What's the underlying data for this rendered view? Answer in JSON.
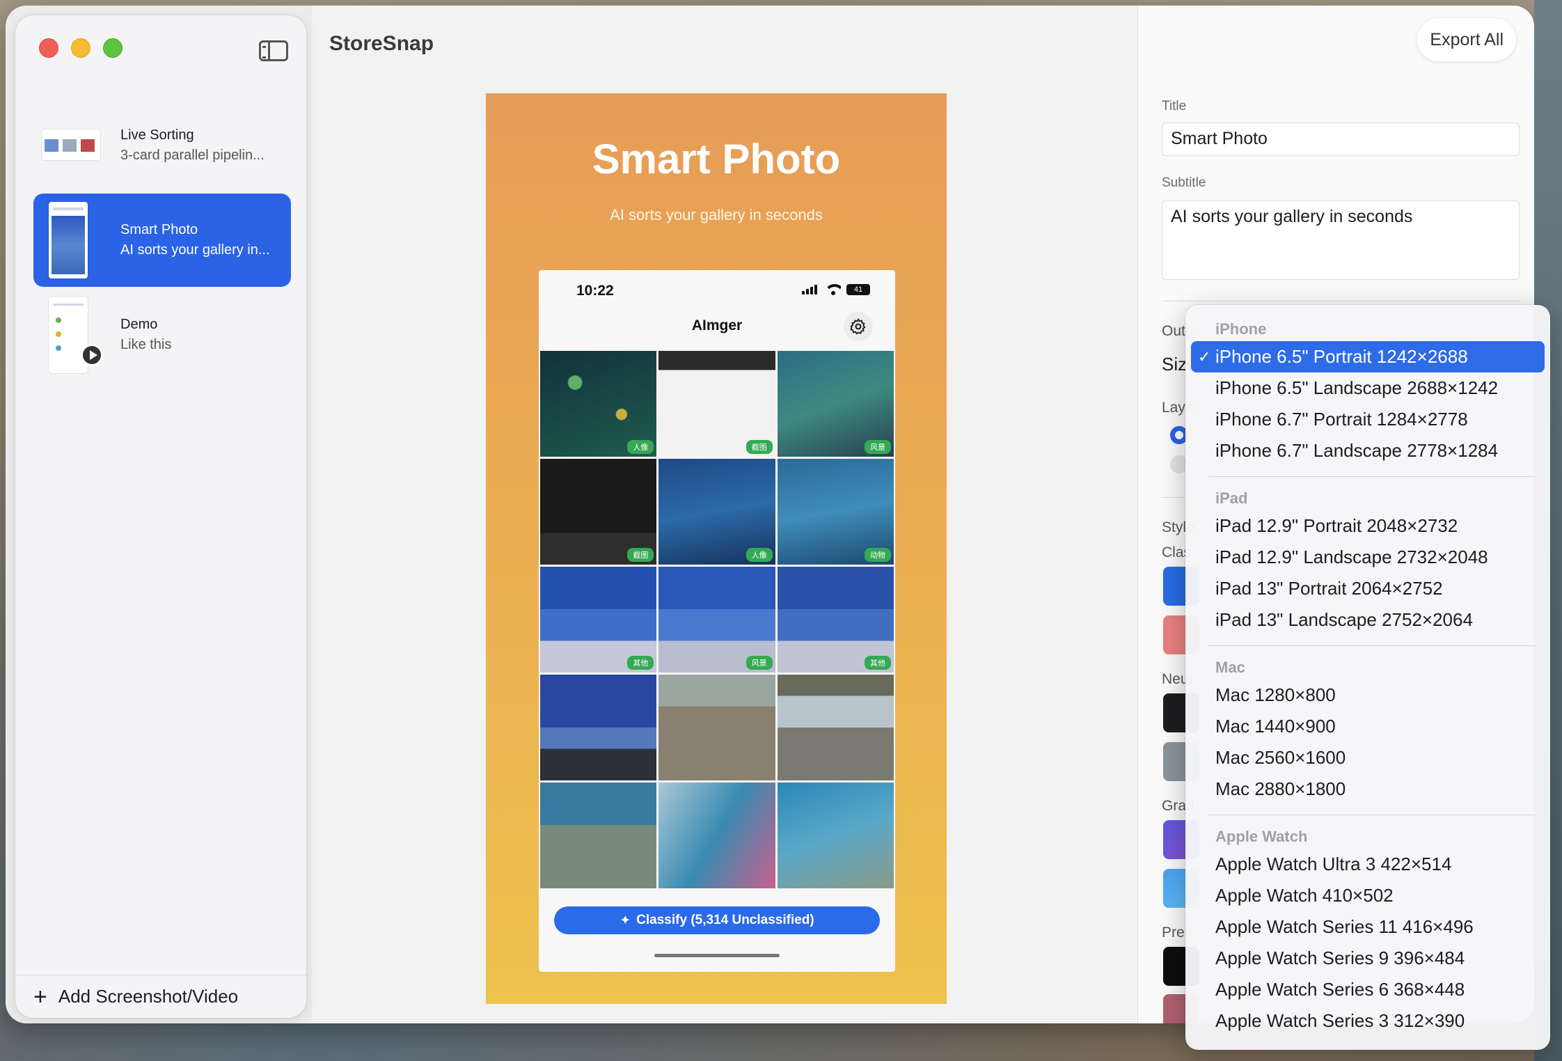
{
  "app": {
    "title": "StoreSnap",
    "export_label": "Export All"
  },
  "sidebar": {
    "items": [
      {
        "title": "Live Sorting",
        "subtitle": "3-card parallel pipelin..."
      },
      {
        "title": "Smart Photo",
        "subtitle": "AI sorts your gallery in..."
      },
      {
        "title": "Demo",
        "subtitle": "Like this"
      }
    ],
    "add_label": "Add Screenshot/Video"
  },
  "poster": {
    "title": "Smart Photo",
    "subtitle": "AI sorts your gallery in seconds",
    "phone": {
      "time": "10:22",
      "battery": "41",
      "app_name": "AImger",
      "tags": [
        "人像",
        "截图",
        "风景",
        "截图",
        "人像",
        "动物",
        "其他",
        "风景",
        "其他",
        "",
        "",
        "",
        "",
        "",
        ""
      ],
      "classify_label": "Classify (5,314 Unclassified)"
    }
  },
  "inspector": {
    "title_label": "Title",
    "title_value": "Smart Photo",
    "subtitle_label": "Subtitle",
    "subtitle_value": "AI sorts your gallery in seconds",
    "clipped": [
      "Outp",
      "Size",
      "Layo",
      "Style",
      "Clas",
      "Neut",
      "Grad",
      "Pren"
    ]
  },
  "size_menu": {
    "sections": [
      {
        "header": "iPhone",
        "items": [
          "iPhone 6.5\" Portrait 1242×2688",
          "iPhone 6.5\" Landscape 2688×1242",
          "iPhone 6.7\" Portrait 1284×2778",
          "iPhone 6.7\" Landscape 2778×1284"
        ]
      },
      {
        "header": "iPad",
        "items": [
          "iPad 12.9\" Portrait 2048×2732",
          "iPad 12.9\" Landscape 2732×2048",
          "iPad 13\" Portrait 2064×2752",
          "iPad 13\" Landscape 2752×2064"
        ]
      },
      {
        "header": "Mac",
        "items": [
          "Mac 1280×800",
          "Mac 1440×900",
          "Mac 2560×1600",
          "Mac 2880×1800"
        ]
      },
      {
        "header": "Apple Watch",
        "items": [
          "Apple Watch Ultra 3 422×514",
          "Apple Watch 410×502",
          "Apple Watch Series 11 416×496",
          "Apple Watch Series 9 396×484",
          "Apple Watch Series 6 368×448",
          "Apple Watch Series 3 312×390"
        ]
      }
    ],
    "selected": "iPhone 6.5\" Portrait 1242×2688"
  },
  "colors": {
    "accent": "#2a63e6",
    "tag_green": "#35a954"
  }
}
